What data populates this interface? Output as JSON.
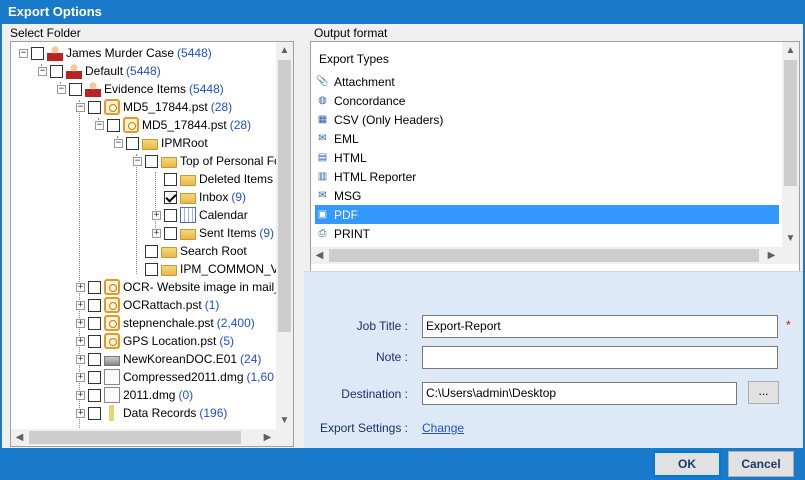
{
  "window": {
    "title": "Export Options"
  },
  "left_panel": {
    "label": "Select Folder"
  },
  "tree": [
    {
      "label": "James Murder Case",
      "count": "(5448)",
      "icon": "case-icon"
    },
    {
      "label": "Default",
      "count": "(5448)",
      "icon": "person-icon"
    },
    {
      "label": "Evidence Items",
      "count": "(5448)",
      "icon": "person-icon"
    },
    {
      "label": "MD5_17844.pst",
      "count": "(28)",
      "icon": "clock-icon"
    },
    {
      "label": "MD5_17844.pst",
      "count": "(28)",
      "icon": "clock-icon"
    },
    {
      "label": "IPMRoot",
      "count": "",
      "icon": "folder-icon"
    },
    {
      "label": "Top of Personal Fo",
      "count": "",
      "icon": "folder-icon"
    },
    {
      "label": "Deleted Items",
      "count": "",
      "icon": "folder-icon"
    },
    {
      "label": "Inbox",
      "count": "(9)",
      "icon": "folder-icon",
      "checked": true
    },
    {
      "label": "Calendar",
      "count": "",
      "icon": "calendar-icon"
    },
    {
      "label": "Sent Items",
      "count": "(9)",
      "icon": "folder-icon"
    },
    {
      "label": "Search Root",
      "count": "",
      "icon": "folder-icon"
    },
    {
      "label": "IPM_COMMON_V",
      "count": "",
      "icon": "folder-icon"
    },
    {
      "label": "OCR- Website image in mail_",
      "count": "",
      "icon": "clock-icon"
    },
    {
      "label": "OCRattach.pst",
      "count": "(1)",
      "icon": "clock-icon"
    },
    {
      "label": "stepnenchale.pst",
      "count": "(2,400)",
      "icon": "clock-icon"
    },
    {
      "label": "GPS Location.pst",
      "count": "(5)",
      "icon": "clock-icon"
    },
    {
      "label": "NewKoreanDOC.E01",
      "count": "(24)",
      "icon": "disk-icon"
    },
    {
      "label": "Compressed2011.dmg",
      "count": "(1,60",
      "icon": "doc-icon"
    },
    {
      "label": "2011.dmg",
      "count": "(0)",
      "icon": "doc-icon"
    },
    {
      "label": "Data Records",
      "count": "(196)",
      "icon": "pen-icon"
    }
  ],
  "right_panel": {
    "label": "Output format",
    "list_header": "Export Types"
  },
  "formats": [
    {
      "label": "Attachment",
      "icon": "paperclip-icon"
    },
    {
      "label": "Concordance",
      "icon": "concordance-icon"
    },
    {
      "label": "CSV (Only Headers)",
      "icon": "csv-icon"
    },
    {
      "label": "EML",
      "icon": "eml-icon"
    },
    {
      "label": "HTML",
      "icon": "html-icon"
    },
    {
      "label": "HTML Reporter",
      "icon": "html-reporter-icon"
    },
    {
      "label": "MSG",
      "icon": "msg-icon"
    },
    {
      "label": "PDF",
      "icon": "pdf-icon",
      "selected": true
    },
    {
      "label": "PRINT",
      "icon": "printer-icon"
    }
  ],
  "form": {
    "job_title_label": "Job Title :",
    "job_title_value": "Export-Report",
    "required_mark": "*",
    "note_label": "Note :",
    "note_value": "",
    "destination_label": "Destination :",
    "destination_value": "C:\\Users\\admin\\Desktop",
    "browse_label": "...",
    "export_settings_label": "Export Settings :",
    "change_link": "Change"
  },
  "buttons": {
    "ok": "OK",
    "cancel": "Cancel"
  },
  "colors": {
    "title_bar": "#1979ca",
    "selection": "#3399ff",
    "link": "#1e50d2",
    "form_bg": "#dde9f6"
  }
}
